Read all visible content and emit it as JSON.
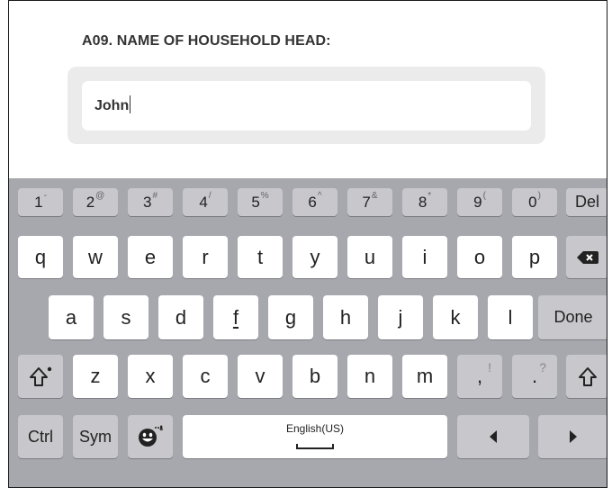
{
  "form": {
    "question_label": "A09. NAME OF HOUSEHOLD HEAD:",
    "answer_value": "John"
  },
  "keyboard": {
    "number_row": [
      {
        "main": "1",
        "sub": "-"
      },
      {
        "main": "2",
        "sub": "@"
      },
      {
        "main": "3",
        "sub": "#"
      },
      {
        "main": "4",
        "sub": "/"
      },
      {
        "main": "5",
        "sub": "%"
      },
      {
        "main": "6",
        "sub": "^"
      },
      {
        "main": "7",
        "sub": "&"
      },
      {
        "main": "8",
        "sub": "*"
      },
      {
        "main": "9",
        "sub": "("
      },
      {
        "main": "0",
        "sub": ")"
      }
    ],
    "del": "Del",
    "row_q": [
      "q",
      "w",
      "e",
      "r",
      "t",
      "y",
      "u",
      "i",
      "o",
      "p"
    ],
    "row_a": [
      "a",
      "s",
      "d",
      "f",
      "g",
      "h",
      "j",
      "k",
      "l"
    ],
    "done": "Done",
    "row_z": [
      "z",
      "x",
      "c",
      "v",
      "b",
      "n",
      "m"
    ],
    "comma": ",",
    "comma_alt": "!",
    "period": ".",
    "period_alt": "?",
    "ctrl": "Ctrl",
    "sym": "Sym",
    "language": "English(US)",
    "icons": {
      "backspace": "backspace-icon",
      "shift": "shift-icon",
      "emoji": "emoji-icon",
      "arrow_left": "arrow-left-icon",
      "arrow_right": "arrow-right-icon",
      "space": "space-bar-icon"
    }
  }
}
